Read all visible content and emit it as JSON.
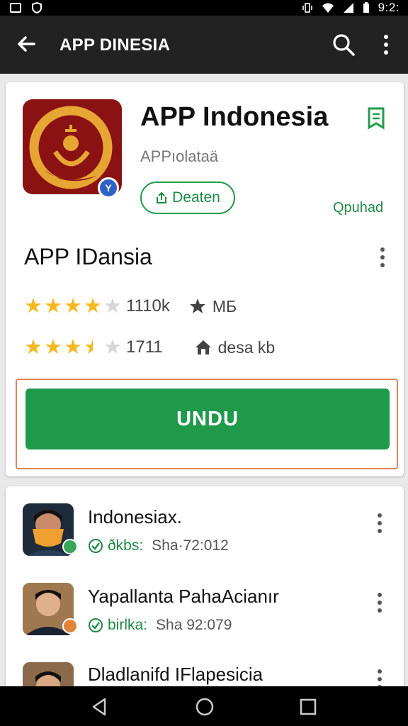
{
  "status_bar": {
    "time": "9:2:",
    "icons": [
      "image-icon",
      "shield-icon",
      "vibrate-icon",
      "wifi-icon",
      "signal-icon",
      "battery-icon"
    ]
  },
  "app_bar": {
    "title": "APP DINESIA",
    "icons": [
      "back-arrow-icon",
      "search-icon",
      "more-vert-icon"
    ]
  },
  "app_card": {
    "name": "APP Indonesia",
    "developer": "APPıolataä",
    "follow_label": "Deaten",
    "green_link": "Qpuhad",
    "sub_name": "APP IDansia",
    "rating_rows": [
      {
        "stars": 4,
        "text": "1110k",
        "meta_icon": "star-badge-icon",
        "meta_text": "MБ"
      },
      {
        "stars": 3.5,
        "text": "1711",
        "meta_icon": "home-icon",
        "meta_text": "desa kb"
      }
    ],
    "install_label": "UNDU",
    "colors": {
      "accent_green": "#1f9a4b",
      "icon_red": "#8b1212",
      "icon_gold": "#e7a534",
      "highlight_border": "#e0855a"
    }
  },
  "list": [
    {
      "name": "Indonesiax.",
      "tag": "ðkbs:",
      "info": "Sha·72:012",
      "avatar": "masked-person-avatar"
    },
    {
      "name": "Yapallanta PahaAcianır",
      "tag": "birlka:",
      "info": "Sha 92:079",
      "avatar": "man-avatar"
    },
    {
      "name": "Dladlanifd IFlapesicia",
      "tag": "",
      "info": "",
      "avatar": "person-avatar"
    }
  ],
  "nav_bar": {
    "icons": [
      "back-triangle-icon",
      "home-circle-icon",
      "recents-square-icon"
    ]
  }
}
